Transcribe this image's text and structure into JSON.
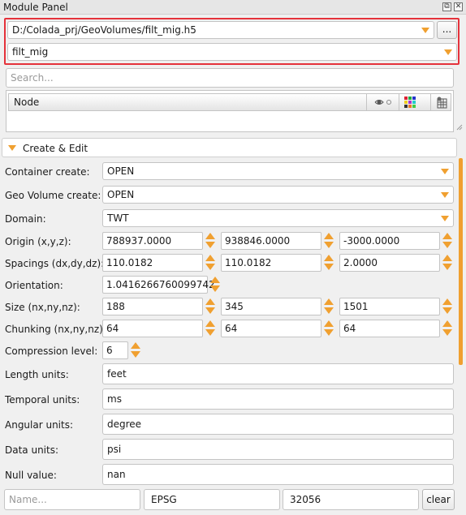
{
  "panel": {
    "title": "Module Panel"
  },
  "file": {
    "path": "D:/Colada_prj/GeoVolumes/filt_mig.h5",
    "browse_label": "...",
    "dataset": "filt_mig"
  },
  "search": {
    "placeholder": "Search..."
  },
  "tree": {
    "column": "Node"
  },
  "section": {
    "title": "Create & Edit"
  },
  "form": {
    "container_create": {
      "label": "Container create:",
      "value": "OPEN"
    },
    "geovolume_create": {
      "label": "Geo Volume create:",
      "value": "OPEN"
    },
    "domain": {
      "label": "Domain:",
      "value": "TWT"
    },
    "origin": {
      "label": "Origin (x,y,z):",
      "x": "788937.0000",
      "y": "938846.0000",
      "z": "-3000.0000"
    },
    "spacings": {
      "label": "Spacings (dx,dy,dz):",
      "x": "110.0182",
      "y": "110.0182",
      "z": "2.0000"
    },
    "orientation": {
      "label": "Orientation:",
      "value": "1.0416266760099742"
    },
    "size": {
      "label": "Size (nx,ny,nz):",
      "x": "188",
      "y": "345",
      "z": "1501"
    },
    "chunking": {
      "label": "Chunking (nx,ny,nz):",
      "x": "64",
      "y": "64",
      "z": "64"
    },
    "compression": {
      "label": "Compression level:",
      "value": "6"
    },
    "length_units": {
      "label": "Length units:",
      "value": "feet"
    },
    "temporal_units": {
      "label": "Temporal units:",
      "value": "ms"
    },
    "angular_units": {
      "label": "Angular units:",
      "value": "degree"
    },
    "data_units": {
      "label": "Data units:",
      "value": "psi"
    },
    "null_value": {
      "label": "Null value:",
      "value": "nan"
    }
  },
  "crs": {
    "name_placeholder": "Name...",
    "authority": "EPSG",
    "code": "32056",
    "clear_label": "clear"
  },
  "colors": {
    "accent": "#f0a030",
    "highlight": "#e5323b"
  }
}
